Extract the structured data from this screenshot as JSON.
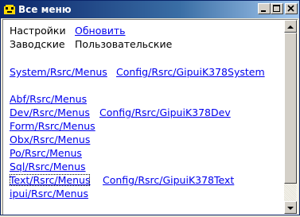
{
  "window": {
    "title": "Все меню",
    "icon": "pacman-icon"
  },
  "rows": {
    "settings_label": "Настройки",
    "refresh_link": "Обновить",
    "factory_label": "Заводские",
    "user_label": "Пользовательские"
  },
  "links": {
    "system_menus": "System/Rsrc/Menus",
    "config_system": "Config/Rsrc/GipuiK378System",
    "abf_menus": "Abf/Rsrc/Menus",
    "dev_menus": "Dev/Rsrc/Menus",
    "config_dev": "Config/Rsrc/GipuiK378Dev",
    "form_menus": "Form/Rsrc/Menus",
    "obx_menus": "Obx/Rsrc/Menus",
    "po_menus": "Po/Rsrc/Menus",
    "sql_menus": "Sql/Rsrc/Menus",
    "text_menus": "Text/Rsrc/Menus",
    "config_text": "Config/Rsrc/GipuiK378Text",
    "ipui_menus": "ipui/Rsrc/Menus"
  },
  "colors": {
    "link": "#0000ee",
    "titlebar": "#0a246a",
    "window": "#ece9d8"
  }
}
